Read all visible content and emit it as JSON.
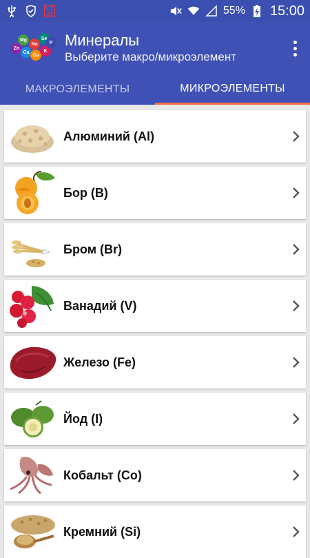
{
  "status": {
    "battery": "55%",
    "time": "15:00",
    "cal_top": "ICE",
    "cal_bottom": "28"
  },
  "app": {
    "title": "Минералы",
    "subtitle": "Выберите макро/микроэлемент"
  },
  "tabs": [
    {
      "label": "МАКРОЭЛЕМЕНТЫ",
      "active": false
    },
    {
      "label": "МИКРОЭЛЕМЕНТЫ",
      "active": true
    }
  ],
  "items": [
    {
      "label": "Алюминий (Al)",
      "icon": "oat-flakes-icon"
    },
    {
      "label": "Бор (B)",
      "icon": "apricot-icon"
    },
    {
      "label": "Бром (Br)",
      "icon": "wheat-icon"
    },
    {
      "label": "Ванадий (V)",
      "icon": "radish-icon"
    },
    {
      "label": "Железо (Fe)",
      "icon": "liver-icon"
    },
    {
      "label": "Йод (I)",
      "icon": "feijoa-icon"
    },
    {
      "label": "Кобальт (Co)",
      "icon": "squid-icon"
    },
    {
      "label": "Кремний (Si)",
      "icon": "grain-icon"
    }
  ],
  "logo_letters": [
    "Zn",
    "Ca",
    "Mg",
    "Na",
    "Cu",
    "K",
    "Se",
    "P"
  ],
  "colors": {
    "primary": "#3f51b5",
    "status": "#3a4fb0",
    "tab_indicator": "#ff7043"
  }
}
